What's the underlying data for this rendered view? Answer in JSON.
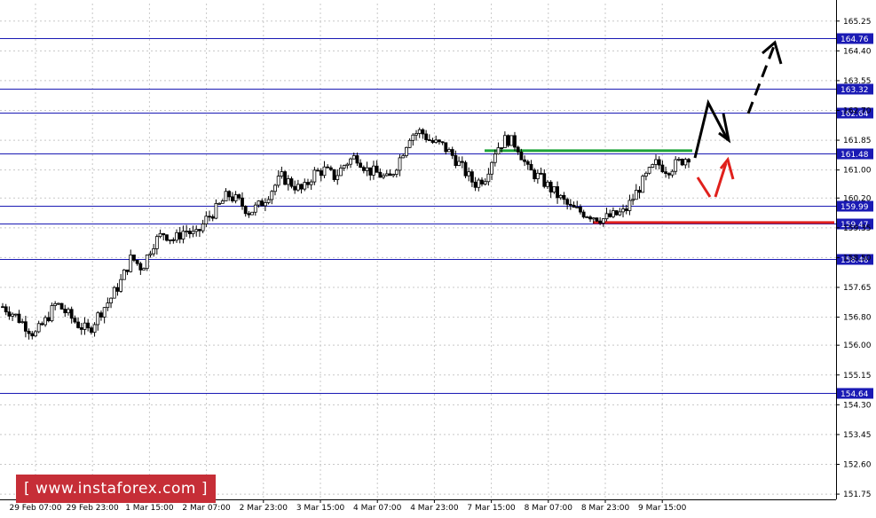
{
  "chart_data": {
    "type": "candlestick",
    "y_axis_ticks": [
      "165.25",
      "164.40",
      "163.55",
      "162.70",
      "161.85",
      "161.00",
      "160.20",
      "159.35",
      "158.50",
      "157.65",
      "156.80",
      "156.00",
      "155.15",
      "154.30",
      "153.45",
      "152.60",
      "151.75"
    ],
    "ylim": [
      151.6,
      165.75
    ],
    "x_axis_ticks": [
      "29 Feb 07:00",
      "29 Feb 23:00",
      "1 Mar 15:00",
      "2 Mar 07:00",
      "2 Mar 23:00",
      "3 Mar 15:00",
      "4 Mar 07:00",
      "4 Mar 23:00",
      "7 Mar 15:00",
      "8 Mar 07:00",
      "8 Mar 23:00",
      "9 Mar 15:00"
    ],
    "level_lines": [
      {
        "label": "164.76",
        "value": 164.76
      },
      {
        "label": "163.32",
        "value": 163.32
      },
      {
        "label": "162.64",
        "value": 162.64
      },
      {
        "label": "161.48",
        "value": 161.48
      },
      {
        "label": "159.99",
        "value": 159.99
      },
      {
        "label": "159.47",
        "value": 159.47
      },
      {
        "label": "158.46",
        "value": 158.46
      },
      {
        "label": "154.64",
        "value": 154.64
      }
    ],
    "annotation_lines": [
      {
        "name": "green-level",
        "value": 161.55,
        "color": "#1fa33a"
      },
      {
        "name": "red-level",
        "value": 159.5,
        "color": "#e0201c"
      }
    ],
    "close_path": [
      157.1,
      156.9,
      156.6,
      156.3,
      156.7,
      157.2,
      156.9,
      156.6,
      156.4,
      156.9,
      157.3,
      157.8,
      158.5,
      158.2,
      158.9,
      159.2,
      159.0,
      159.3,
      159.1,
      159.6,
      159.9,
      160.3,
      160.1,
      159.8,
      160.0,
      160.4,
      160.8,
      160.6,
      160.4,
      160.9,
      161.0,
      160.8,
      161.2,
      161.4,
      161.0,
      160.9,
      160.7,
      161.3,
      162.0,
      162.1,
      161.8,
      161.7,
      161.4,
      161.0,
      160.6,
      160.8,
      161.6,
      161.9,
      161.7,
      161.0,
      160.8,
      160.5,
      160.2,
      159.9,
      159.8,
      159.7,
      159.6,
      159.7,
      159.8,
      160.3,
      160.8,
      161.2,
      161.0,
      161.2,
      161.4
    ],
    "colors": {
      "candles": "#000000",
      "level_lines": "#1a1ab4",
      "label_bg": "#1a1ab4",
      "forecast_black": "#000000",
      "forecast_red": "#e0201c",
      "grid": "#c8c8c8"
    },
    "grid": true
  },
  "watermark": {
    "text": "[ www.instaforex.com ]"
  }
}
